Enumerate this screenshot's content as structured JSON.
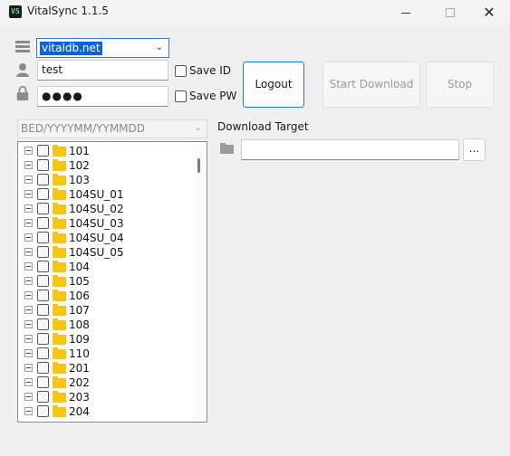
{
  "window": {
    "title": "VitalSync 1.1.5",
    "icon_text": "VS",
    "close_glyph": "✕"
  },
  "login": {
    "server_value": "vitaldb.net",
    "id_value": "test",
    "pw_masked": "●●●●",
    "save_id_label": "Save ID",
    "save_pw_label": "Save PW",
    "save_id_checked": false,
    "save_pw_checked": false
  },
  "toolbar": {
    "logout_label": "Logout",
    "start_label": "Start Download",
    "stop_label": "Stop"
  },
  "filter": {
    "format_placeholder": "BED/YYYYMM/YYMMDD"
  },
  "tree": {
    "items": [
      "101",
      "102",
      "103",
      "104SU_01",
      "104SU_02",
      "104SU_03",
      "104SU_04",
      "104SU_05",
      "104",
      "105",
      "106",
      "107",
      "108",
      "109",
      "110",
      "201",
      "202",
      "203",
      "204"
    ]
  },
  "download": {
    "label": "Download Target",
    "path_value": "",
    "browse_label": "..."
  },
  "colors": {
    "accent": "#2c6fcf",
    "selection": "#0a64d8",
    "folder": "#f5c518"
  },
  "icons": {
    "server": "server-icon",
    "user": "user-icon",
    "lock": "lock-icon",
    "folder": "folder-icon"
  }
}
